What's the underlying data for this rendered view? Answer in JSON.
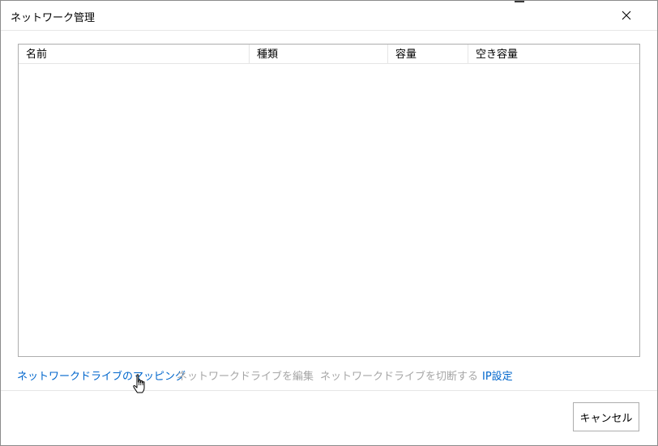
{
  "window": {
    "title": "ネットワーク管理",
    "close_icon": "close-icon"
  },
  "table": {
    "columns": [
      "名前",
      "種類",
      "容量",
      "空き容量"
    ],
    "rows": []
  },
  "actions": [
    {
      "label": "ネットワークドライブのマッピング",
      "enabled": true
    },
    {
      "label": "ネットワークドライブを編集",
      "enabled": false
    },
    {
      "label": "ネットワークドライブを切断する",
      "enabled": false
    },
    {
      "label": "IP設定",
      "enabled": true
    }
  ],
  "footer": {
    "cancel_label": "キャンセル"
  },
  "colors": {
    "link": "#0066cc",
    "disabled": "#a6a6a6",
    "border": "#adadad"
  },
  "cursor": "hand-pointer-icon"
}
